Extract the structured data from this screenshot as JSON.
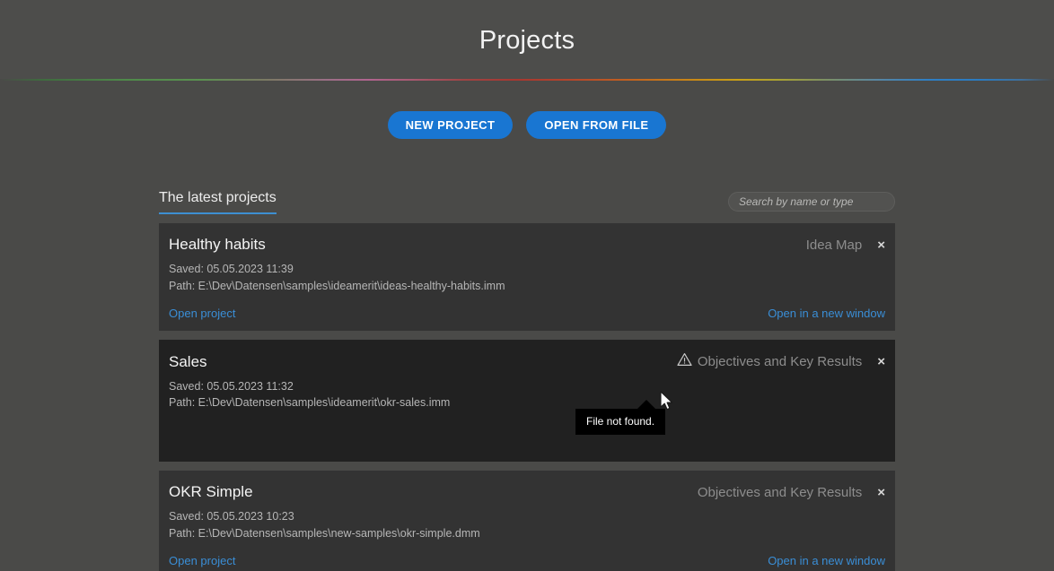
{
  "header": {
    "title": "Projects",
    "rule": "rainbow-gradient-rule"
  },
  "toolbar": {
    "new_project_label": "NEW PROJECT",
    "open_from_file_label": "OPEN FROM FILE",
    "accent_color": "#1976d2"
  },
  "section": {
    "title": "The latest projects",
    "underline_color": "#3d8fd1"
  },
  "search": {
    "value": "",
    "placeholder": "Search by name or type"
  },
  "projects": [
    {
      "name": "Healthy habits",
      "type": "Idea Map",
      "saved": "Saved: 05.05.2023 11:39",
      "path": "Path: E:\\Dev\\Datensen\\samples\\ideamerit\\ideas-healthy-habits.imm",
      "open_label": "Open project",
      "open_new_window_label": "Open in a new window",
      "close_label": "×",
      "has_warning": false,
      "hovered": false
    },
    {
      "name": "Sales",
      "type": "Objectives and Key Results",
      "saved": "Saved: 05.05.2023 11:32",
      "path": "Path: E:\\Dev\\Datensen\\samples\\ideamerit\\okr-sales.imm",
      "open_label": "",
      "open_new_window_label": "",
      "close_label": "×",
      "has_warning": true,
      "hovered": true
    },
    {
      "name": "OKR Simple",
      "type": "Objectives and Key Results",
      "saved": "Saved: 05.05.2023 10:23",
      "path": "Path: E:\\Dev\\Datensen\\samples\\new-samples\\okr-simple.dmm",
      "open_label": "Open project",
      "open_new_window_label": "Open in a new window",
      "close_label": "×",
      "has_warning": false,
      "hovered": false
    }
  ],
  "tooltip": {
    "text": "File not found."
  }
}
